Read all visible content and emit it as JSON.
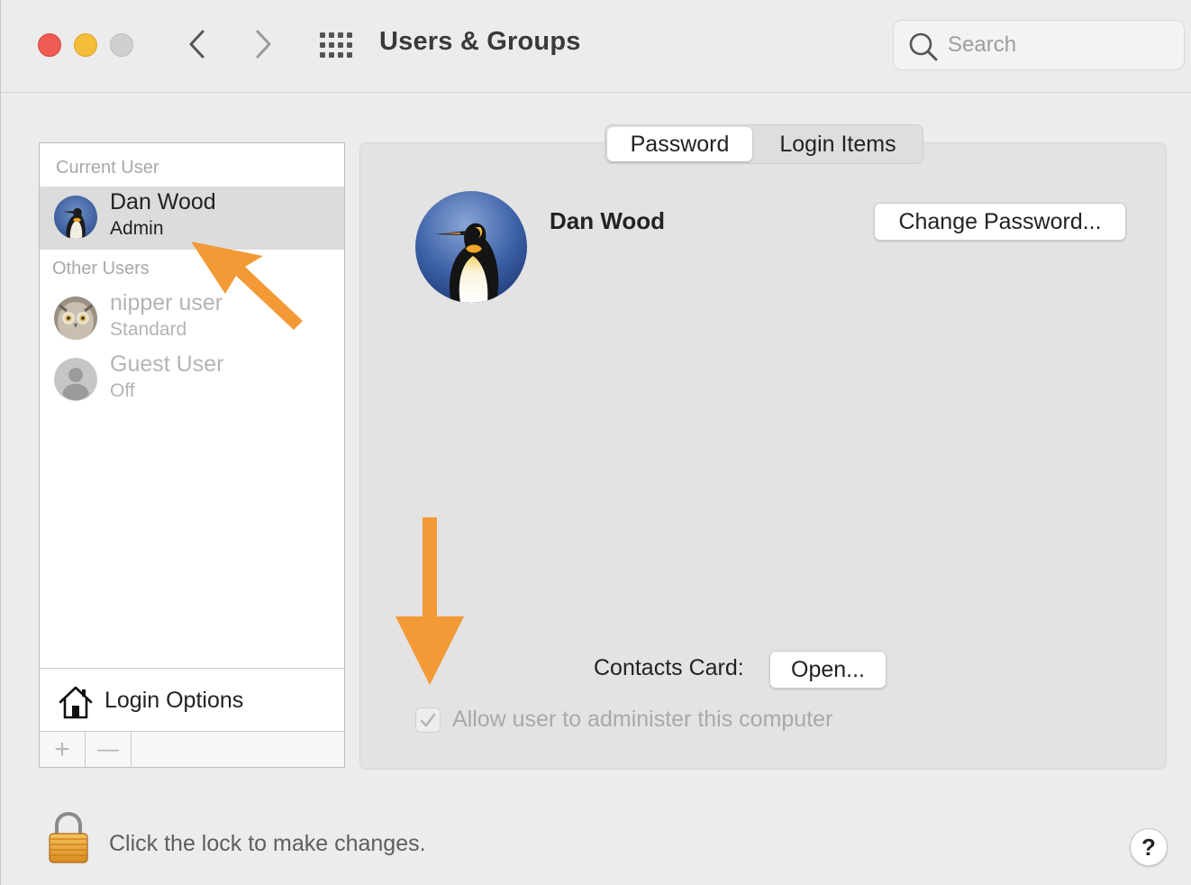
{
  "window": {
    "title": "Users & Groups",
    "search_placeholder": "Search"
  },
  "sidebar": {
    "current_user_heading": "Current User",
    "other_users_heading": "Other Users",
    "users": [
      {
        "name": "Dan Wood",
        "role": "Admin",
        "selected": true,
        "avatar": "penguin-avatar"
      },
      {
        "name": "nipper user",
        "role": "Standard",
        "selected": false,
        "avatar": "owl-avatar"
      },
      {
        "name": "Guest User",
        "role": "Off",
        "selected": false,
        "avatar": "generic-user-avatar"
      }
    ],
    "login_options_label": "Login Options",
    "add_symbol": "+",
    "remove_symbol": "—"
  },
  "tabs": [
    {
      "label": "Password",
      "active": true
    },
    {
      "label": "Login Items",
      "active": false
    }
  ],
  "profile": {
    "name": "Dan Wood",
    "change_password_label": "Change Password...",
    "contacts_card_label": "Contacts Card:",
    "open_label": "Open...",
    "admin_checkbox_label": "Allow user to administer this computer",
    "admin_checked": true,
    "admin_enabled": false
  },
  "footer": {
    "lock_text": "Click the lock to make changes.",
    "help_label": "?"
  },
  "colors": {
    "annotation_arrow": "#f39a36",
    "close": "#ee5c54",
    "minimize": "#f5bd39",
    "zoom_disabled": "#cfcfcf"
  }
}
